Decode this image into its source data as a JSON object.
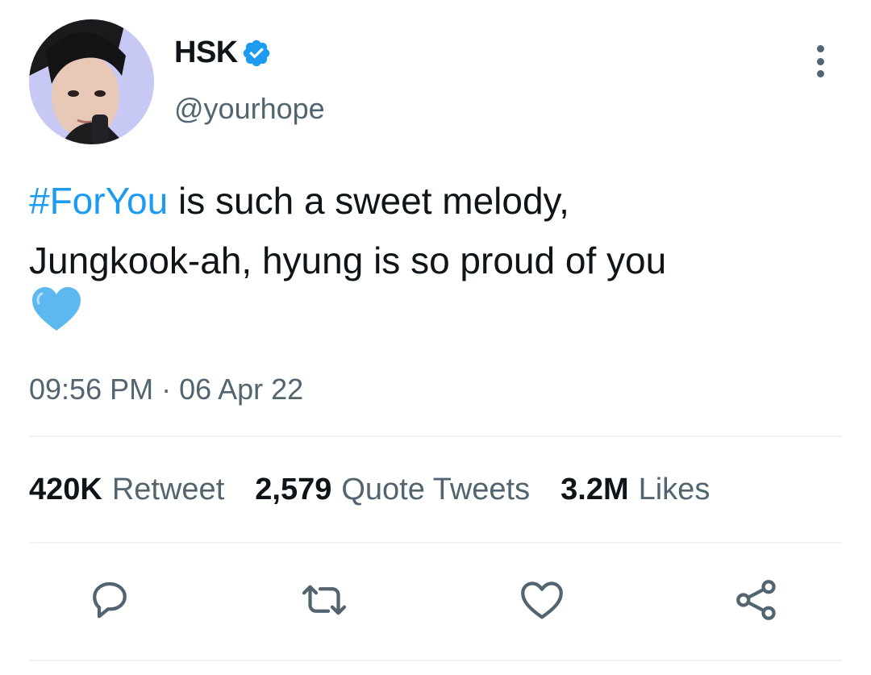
{
  "author": {
    "display_name": "HSK",
    "handle": "@yourhope",
    "verified": true,
    "avatar_icon": "profile-photo"
  },
  "tweet": {
    "hashtag": "#ForYou",
    "text_line1_rest": " is such a sweet melody,",
    "text_line2": "Jungkook-ah, hyung is so proud of you",
    "emoji": "blue-heart"
  },
  "timestamp": "09:56 PM · 06 Apr 22",
  "stats": {
    "retweets": {
      "value": "420K",
      "label": "Retweet"
    },
    "quotes": {
      "value": "2,579",
      "label": "Quote Tweets"
    },
    "likes": {
      "value": "3.2M",
      "label": "Likes"
    }
  },
  "actions": [
    "reply-icon",
    "retweet-icon",
    "like-icon",
    "share-icon"
  ],
  "colors": {
    "accent": "#1d9bf0",
    "muted": "#536471",
    "text": "#0f1419",
    "divider": "#eff3f4"
  }
}
